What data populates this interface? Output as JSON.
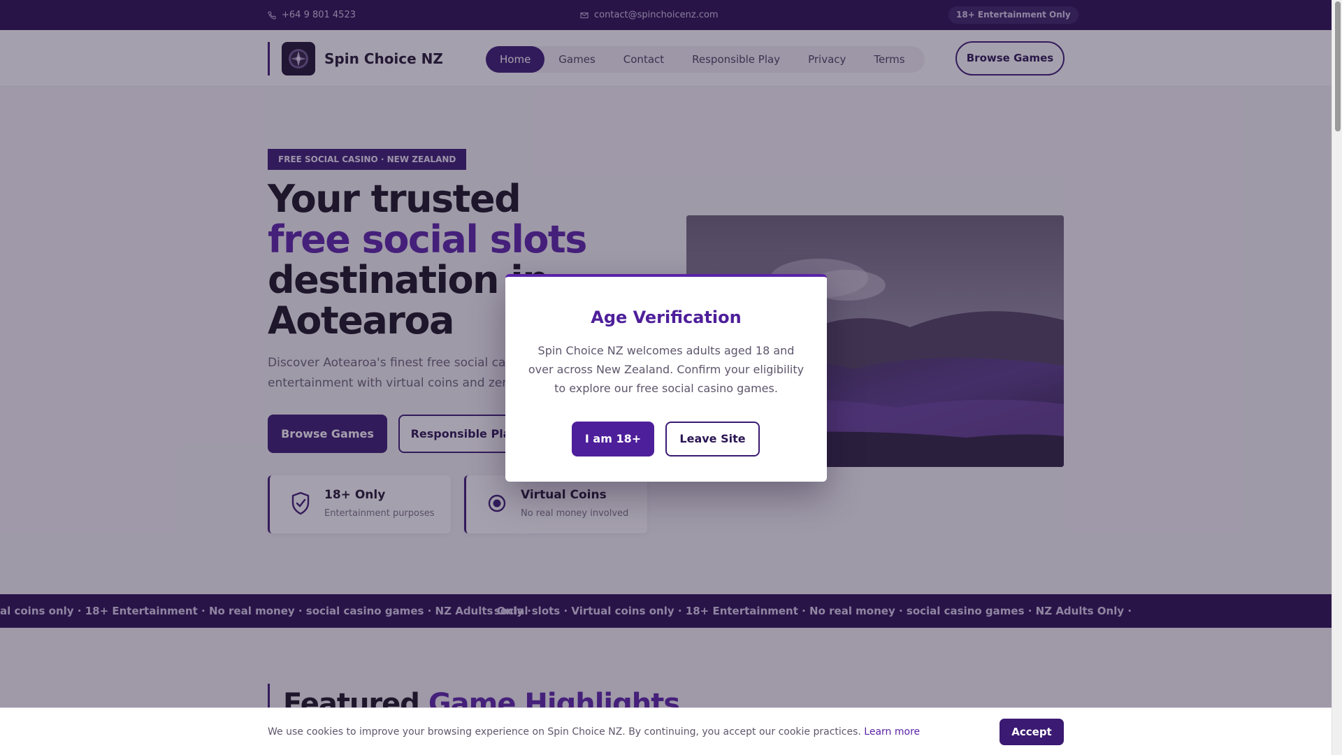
{
  "topbar": {
    "phone": "+64 9 801 4523",
    "email": "contact@spinchoicenz.com",
    "badge": "18+ Entertainment Only"
  },
  "header": {
    "brand": "Spin Choice NZ",
    "nav": [
      {
        "label": "Home",
        "active": true
      },
      {
        "label": "Games"
      },
      {
        "label": "Contact"
      },
      {
        "label": "Responsible Play"
      },
      {
        "label": "Privacy"
      },
      {
        "label": "Terms"
      }
    ],
    "cta": "Browse Games"
  },
  "hero": {
    "tag": "FREE SOCIAL CASINO · NEW ZEALAND",
    "title_pre": "Your trusted ",
    "title_accent": "free social slots",
    "title_post": " destination in Aotearoa",
    "lead": "Discover Aotearoa's finest free social casino entertainment with virtual coins and zero real money",
    "btn_primary": "Browse Games",
    "btn_secondary": "Responsible Play",
    "cards": [
      {
        "title": "18+ Only",
        "sub": "Entertainment purposes",
        "icon": "shield-check-icon"
      },
      {
        "title": "Virtual Coins",
        "sub": "No real money involved",
        "icon": "coin-icon"
      }
    ]
  },
  "ticker": {
    "segment_a": "al coins only · 18+ Entertainment · No real money · social casino games · NZ Adults Only ·",
    "segment_b": "social slots · Virtual coins only · 18+ Entertainment · No real money · social casino games · NZ Adults Only ·"
  },
  "featured": {
    "title_pre": "Featured ",
    "title_accent": "Game Highlights"
  },
  "modal": {
    "title": "Age Verification",
    "body": "Spin Choice NZ welcomes adults aged 18 and over across New Zealand. Confirm your eligibility to explore our free social casino games.",
    "confirm": "I am 18+",
    "leave": "Leave Site"
  },
  "cookie": {
    "text": "We use cookies to improve your browsing experience on Spin Choice NZ. By continuing, you accept our cookie practices.",
    "link": "Learn more",
    "accept": "Accept"
  },
  "colors": {
    "brand_dark": "#2a0f52",
    "brand_purple": "#3a1a72",
    "accent": "#5a23a8"
  }
}
